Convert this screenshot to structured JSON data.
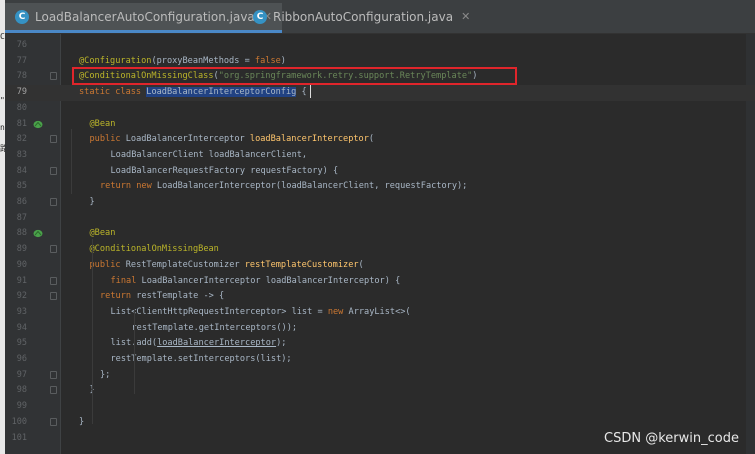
{
  "tabs": [
    {
      "label": "LoadBalancerAutoConfiguration.java",
      "icon": "java-class-icon",
      "icon_letter": "C",
      "active": true,
      "close": "✕"
    },
    {
      "label": "RibbonAutoConfiguration.java",
      "icon": "java-class-icon",
      "icon_letter": "C",
      "active": false,
      "close": "✕"
    }
  ],
  "left_strip_marks": [
    "C",
    "\"",
    "n",
    "路"
  ],
  "editor": {
    "current_line": "79",
    "lines": [
      {
        "num": "76",
        "code": ""
      },
      {
        "num": "77",
        "code": ""
      },
      {
        "num": "78",
        "code": ""
      },
      {
        "num": "79",
        "code": ""
      },
      {
        "num": "80",
        "code": ""
      },
      {
        "num": "81",
        "code": ""
      },
      {
        "num": "82",
        "code": ""
      },
      {
        "num": "83",
        "code": ""
      },
      {
        "num": "84",
        "code": ""
      },
      {
        "num": "85",
        "code": ""
      },
      {
        "num": "86",
        "code": ""
      },
      {
        "num": "87",
        "code": ""
      },
      {
        "num": "88",
        "code": ""
      },
      {
        "num": "89",
        "code": ""
      },
      {
        "num": "90",
        "code": ""
      },
      {
        "num": "91",
        "code": ""
      },
      {
        "num": "92",
        "code": ""
      },
      {
        "num": "93",
        "code": ""
      },
      {
        "num": "94",
        "code": ""
      },
      {
        "num": "95",
        "code": ""
      },
      {
        "num": "96",
        "code": ""
      },
      {
        "num": "97",
        "code": ""
      },
      {
        "num": "98",
        "code": ""
      },
      {
        "num": "99",
        "code": ""
      },
      {
        "num": "100",
        "code": ""
      },
      {
        "num": "101",
        "code": ""
      }
    ],
    "tokens": {
      "l77": [
        [
          "ann",
          "@Configuration"
        ],
        [
          "",
          "(proxyBeanMethods = "
        ],
        [
          "kw",
          "false"
        ],
        [
          "",
          ")"
        ]
      ],
      "l78": [
        [
          "ann",
          "@ConditionalOnMissingClass"
        ],
        [
          "",
          "("
        ],
        [
          "str",
          "\"org.springframework.retry.support.RetryTemplate\""
        ],
        [
          "",
          ")"
        ]
      ],
      "l79": [
        [
          "kw",
          "static class "
        ],
        [
          "hl",
          "LoadBalancerInterceptorConfig"
        ],
        [
          "",
          " {"
        ]
      ],
      "l81": [
        [
          "ann",
          "@Bean"
        ]
      ],
      "l82": [
        [
          "kw",
          "public "
        ],
        [
          "",
          "LoadBalancerInterceptor "
        ],
        [
          "fn",
          "loadBalancerInterceptor"
        ],
        [
          "",
          "("
        ]
      ],
      "l83": [
        [
          "",
          "LoadBalancerClient loadBalancerClient,"
        ]
      ],
      "l84": [
        [
          "",
          "LoadBalancerRequestFactory requestFactory) {"
        ]
      ],
      "l85": [
        [
          "kw",
          "return new "
        ],
        [
          "",
          "LoadBalancerInterceptor(loadBalancerClient, requestFactory);"
        ]
      ],
      "l86": [
        [
          "",
          "}"
        ]
      ],
      "l88": [
        [
          "ann",
          "@Bean"
        ]
      ],
      "l89": [
        [
          "ann",
          "@ConditionalOnMissingBean"
        ]
      ],
      "l90": [
        [
          "kw",
          "public "
        ],
        [
          "",
          "RestTemplateCustomizer "
        ],
        [
          "fn",
          "restTemplateCustomizer"
        ],
        [
          "",
          "("
        ]
      ],
      "l91": [
        [
          "kw",
          "final "
        ],
        [
          "",
          "LoadBalancerInterceptor loadBalancerInterceptor) {"
        ]
      ],
      "l92": [
        [
          "kw",
          "return "
        ],
        [
          "",
          "restTemplate -> {"
        ]
      ],
      "l93": [
        [
          "",
          "List<ClientHttpRequestInterceptor> list = "
        ],
        [
          "kw",
          "new "
        ],
        [
          "",
          "ArrayList<>("
        ]
      ],
      "l94": [
        [
          "",
          "restTemplate.getInterceptors());"
        ]
      ],
      "l95": [
        [
          "",
          "list.add("
        ],
        [
          "ul",
          "loadBalancerInterceptor"
        ],
        [
          "",
          ");"
        ]
      ],
      "l96": [
        [
          "",
          "restTemplate.setInterceptors(list);"
        ]
      ],
      "l97": [
        [
          "",
          "};"
        ]
      ],
      "l98": [
        [
          "",
          "}"
        ]
      ],
      "l100": [
        [
          "",
          "}"
        ]
      ]
    },
    "indent": {
      "l77": 24,
      "l78": 24,
      "l79": 24,
      "l81": 45,
      "l82": 45,
      "l83": 87,
      "l84": 87,
      "l85": 66,
      "l86": 45,
      "l88": 45,
      "l89": 45,
      "l90": 45,
      "l91": 87,
      "l92": 66,
      "l93": 87,
      "l94": 129,
      "l95": 87,
      "l96": 87,
      "l97": 66,
      "l98": 45,
      "l100": 24
    },
    "bean_icon_lines": [
      "81",
      "88"
    ],
    "fold_lines": [
      "78",
      "82",
      "84",
      "86",
      "89",
      "91",
      "92",
      "97",
      "98",
      "100"
    ]
  },
  "colors": {
    "background": "#2b2b2b",
    "keyword": "#cc7832",
    "annotation": "#bbb529",
    "string": "#6a8759",
    "method": "#ffc66d",
    "selection": "#214283",
    "highlight_box": "#e0252b",
    "tab_underline": "#4a88c7"
  },
  "watermark": "CSDN @kerwin_code"
}
